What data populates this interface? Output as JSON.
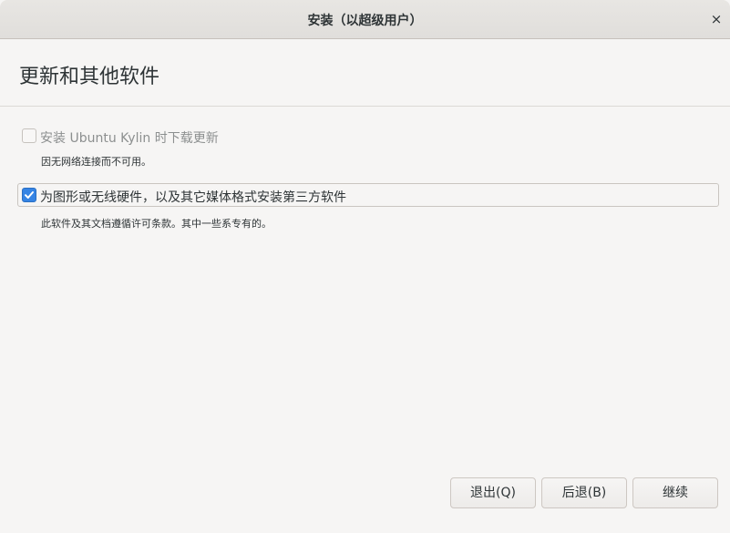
{
  "window": {
    "title": "安装（以超级用户）",
    "close_icon": "×"
  },
  "page": {
    "title": "更新和其他软件"
  },
  "options": [
    {
      "label": "安装 Ubuntu Kylin 时下载更新",
      "checked": false,
      "enabled": false,
      "description": "因无网络连接而不可用。"
    },
    {
      "label": "为图形或无线硬件，以及其它媒体格式安装第三方软件",
      "checked": true,
      "enabled": true,
      "description": "此软件及其文档遵循许可条款。其中一些系专有的。"
    }
  ],
  "buttons": {
    "quit": "退出(Q)",
    "back": "后退(B)",
    "continue": "继续"
  },
  "colors": {
    "accent": "#3584e4",
    "background": "#f6f5f4"
  }
}
